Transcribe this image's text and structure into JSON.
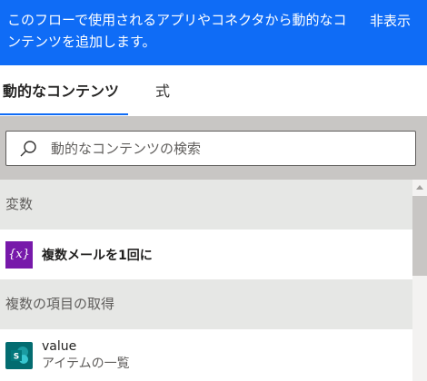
{
  "banner": {
    "text": "このフローで使用されるアプリやコネクタから動的なコンテンツを追加します。",
    "hide_label": "非表示"
  },
  "tabs": [
    {
      "label": "動的なコンテンツ",
      "active": true
    },
    {
      "label": "式",
      "active": false
    }
  ],
  "search": {
    "placeholder": "動的なコンテンツの検索",
    "value": ""
  },
  "sections": [
    {
      "header": "変数",
      "items": [
        {
          "icon": "variable-icon",
          "icon_text": "{x}",
          "title": "複数メールを1回に"
        }
      ]
    },
    {
      "header": "複数の項目の取得",
      "items": [
        {
          "icon": "sharepoint-icon",
          "icon_text": "S",
          "title": "value",
          "subtitle": "アイテムの一覧"
        }
      ]
    }
  ],
  "colors": {
    "accent": "#0f6cf6",
    "variable_icon": "#7719aa",
    "sharepoint_icon": "#036c70"
  }
}
